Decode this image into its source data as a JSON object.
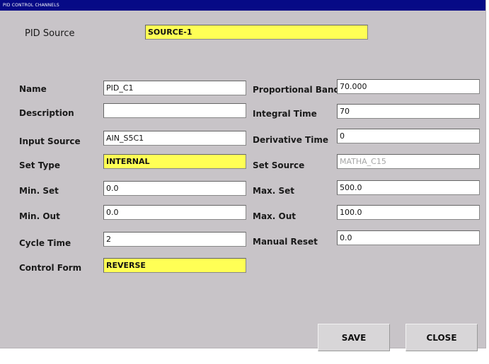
{
  "window": {
    "title": "PID CONTROL CHANNELS"
  },
  "pid_source": {
    "label": "PID Source",
    "value": "SOURCE-1"
  },
  "left_fields": [
    {
      "label": "Name",
      "value": "PID_C1"
    },
    {
      "label": "Description",
      "value": ""
    },
    {
      "label": "Input Source",
      "value": "AIN_S5C1"
    },
    {
      "label": "Set Type",
      "value": "INTERNAL"
    },
    {
      "label": "Min. Set",
      "value": "0.0"
    },
    {
      "label": "Min. Out",
      "value": "0.0"
    },
    {
      "label": "Cycle Time",
      "value": "2"
    },
    {
      "label": "Control Form",
      "value": "REVERSE"
    }
  ],
  "right_fields": [
    {
      "label": "Proportional Band",
      "value": "70.000"
    },
    {
      "label": "Integral Time",
      "value": "70"
    },
    {
      "label": "Derivative Time",
      "value": "0"
    },
    {
      "label": "Set Source",
      "value": "MATHA_C15"
    },
    {
      "label": "Max. Set",
      "value": "500.0"
    },
    {
      "label": "Max. Out",
      "value": "100.0"
    },
    {
      "label": "Manual Reset",
      "value": "0.0"
    }
  ],
  "buttons": {
    "save": "SAVE",
    "close": "CLOSE"
  },
  "colors": {
    "titlebar": "#060a86",
    "highlight_field": "#ffff55",
    "background": "#c8c4c8"
  }
}
